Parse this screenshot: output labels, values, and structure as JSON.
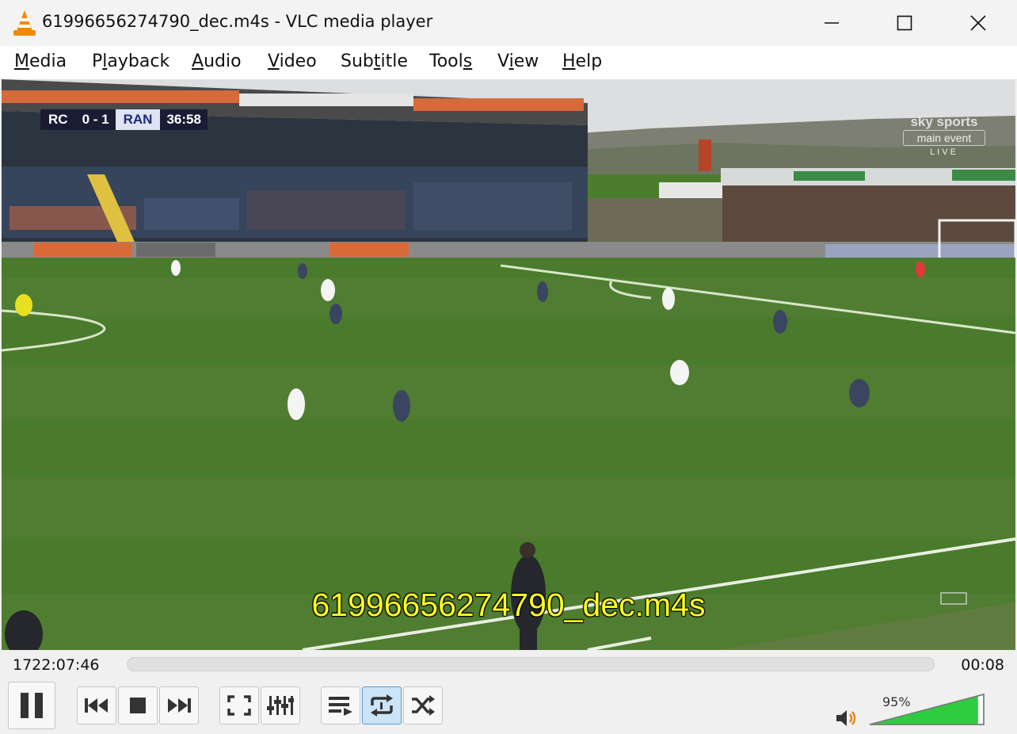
{
  "window": {
    "title": "61996656274790_dec.m4s - VLC media player",
    "app_icon": "vlc-cone-icon",
    "controls": [
      "minimize-icon",
      "maximize-icon",
      "close-icon"
    ]
  },
  "menu": {
    "items": [
      {
        "label": "Media",
        "accel": "M"
      },
      {
        "label": "Playback",
        "accel": "l"
      },
      {
        "label": "Audio",
        "accel": "A"
      },
      {
        "label": "Video",
        "accel": "V"
      },
      {
        "label": "Subtitle",
        "accel": "t"
      },
      {
        "label": "Tools",
        "accel": "s"
      },
      {
        "label": "View",
        "accel": "i"
      },
      {
        "label": "Help",
        "accel": "H"
      }
    ]
  },
  "video": {
    "scorebug": {
      "home": "RC",
      "score": "0 - 1",
      "away": "RAN",
      "clock": "36:58"
    },
    "broadcaster": {
      "line1": "sky sports",
      "line2": "main event",
      "line3": "LIVE"
    },
    "osd_filename": "61996656274790_dec.m4s"
  },
  "seek": {
    "elapsed": "1722:07:46",
    "total": "00:08",
    "progress": 0
  },
  "controls": {
    "buttons": [
      {
        "name": "pause-button",
        "icon": "pause-icon"
      },
      {
        "name": "previous-button",
        "icon": "previous-icon"
      },
      {
        "name": "stop-button",
        "icon": "stop-icon"
      },
      {
        "name": "next-button",
        "icon": "next-icon"
      },
      {
        "name": "fullscreen-button",
        "icon": "fullscreen-icon"
      },
      {
        "name": "extended-settings-button",
        "icon": "equalizer-icon"
      },
      {
        "name": "playlist-button",
        "icon": "playlist-icon"
      },
      {
        "name": "loop-button",
        "icon": "loop-icon",
        "active": true
      },
      {
        "name": "random-button",
        "icon": "shuffle-icon"
      }
    ],
    "volume": {
      "percent_label": "95%",
      "level": 0.95,
      "icon": "speaker-icon"
    }
  },
  "colors": {
    "osd_text": "#ffff22",
    "volume_fill": "#2ecc40",
    "active_button": "#cce4f7",
    "pitch": "#4c7d2d"
  }
}
